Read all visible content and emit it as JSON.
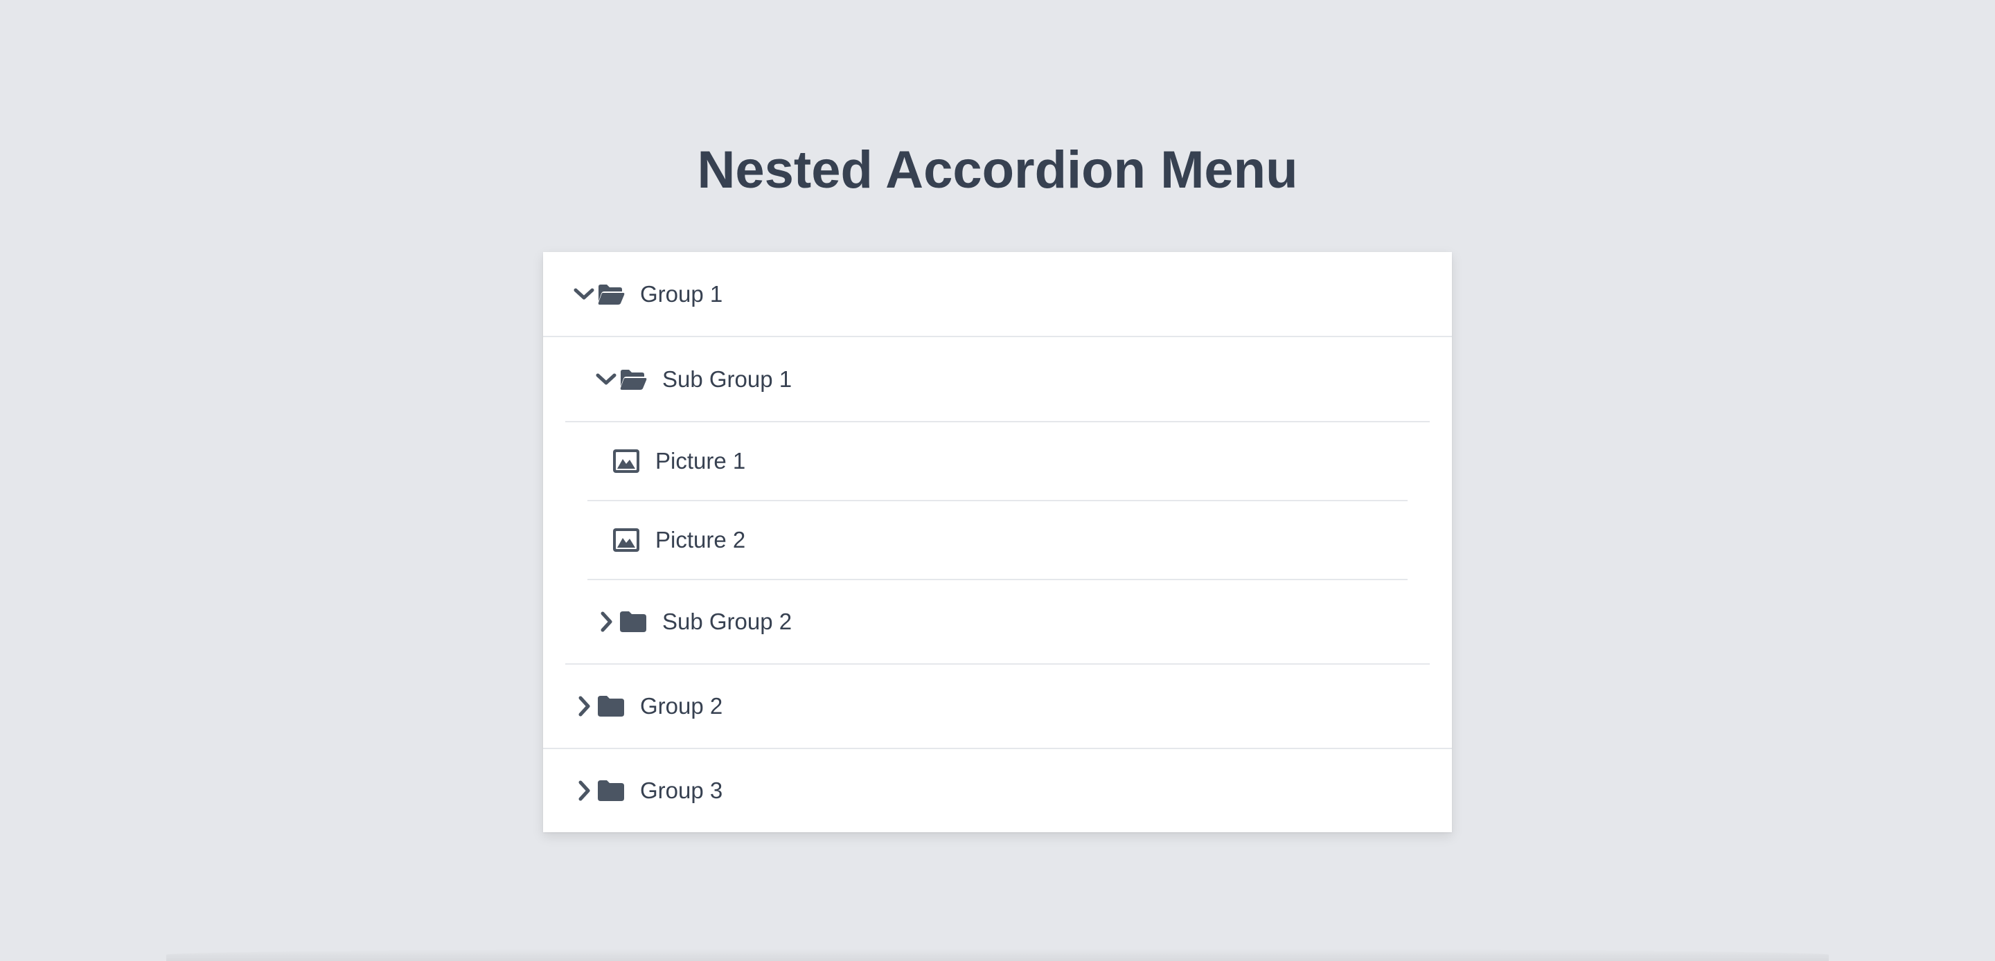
{
  "page": {
    "title": "Nested Accordion Menu"
  },
  "menu": {
    "group1": {
      "label": "Group 1",
      "expanded": true,
      "icon": "folder-open-icon"
    },
    "subgroup1": {
      "label": "Sub Group 1",
      "expanded": true,
      "icon": "folder-open-icon"
    },
    "picture1": {
      "label": "Picture 1",
      "icon": "image-icon"
    },
    "picture2": {
      "label": "Picture 2",
      "icon": "image-icon"
    },
    "subgroup2": {
      "label": "Sub Group 2",
      "expanded": false,
      "icon": "folder-icon"
    },
    "group2": {
      "label": "Group 2",
      "expanded": false,
      "icon": "folder-icon"
    },
    "group3": {
      "label": "Group 3",
      "expanded": false,
      "icon": "folder-icon"
    }
  },
  "colors": {
    "background": "#e5e7eb",
    "panel": "#ffffff",
    "text": "#374151",
    "icon": "#4b5563",
    "divider": "#e5e7eb"
  }
}
